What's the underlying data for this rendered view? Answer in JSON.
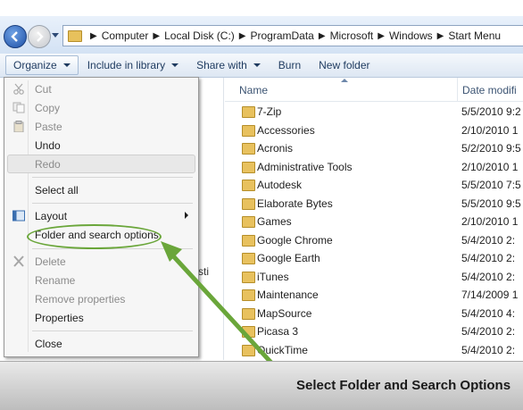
{
  "address": {
    "crumbs": [
      "Computer",
      "Local Disk (C:)",
      "ProgramData",
      "Microsoft",
      "Windows",
      "Start Menu"
    ]
  },
  "toolbar": {
    "organize": "Organize",
    "include": "Include in library",
    "share": "Share with",
    "burn": "Burn",
    "new_folder": "New folder"
  },
  "nav": {
    "partial_text": "sti"
  },
  "list": {
    "col_name": "Name",
    "col_date": "Date modifi",
    "rows": [
      {
        "name": "7-Zip",
        "date": "5/5/2010 9:2"
      },
      {
        "name": "Accessories",
        "date": "2/10/2010 1"
      },
      {
        "name": "Acronis",
        "date": "5/2/2010 9:5"
      },
      {
        "name": "Administrative Tools",
        "date": "2/10/2010 1"
      },
      {
        "name": "Autodesk",
        "date": "5/5/2010 7:5"
      },
      {
        "name": "Elaborate Bytes",
        "date": "5/5/2010 9:5"
      },
      {
        "name": "Games",
        "date": "2/10/2010 1"
      },
      {
        "name": "Google Chrome",
        "date": "5/4/2010 2:"
      },
      {
        "name": "Google Earth",
        "date": "5/4/2010 2:"
      },
      {
        "name": "iTunes",
        "date": "5/4/2010 2:"
      },
      {
        "name": "Maintenance",
        "date": "7/14/2009 1"
      },
      {
        "name": "MapSource",
        "date": "5/4/2010 4:"
      },
      {
        "name": "Picasa 3",
        "date": "5/4/2010 2:"
      },
      {
        "name": "QuickTime",
        "date": "5/4/2010 2:"
      }
    ]
  },
  "menu": {
    "cut": "Cut",
    "copy": "Copy",
    "paste": "Paste",
    "undo": "Undo",
    "redo": "Redo",
    "select_all": "Select all",
    "layout": "Layout",
    "folder_options": "Folder and search options",
    "delete": "Delete",
    "rename": "Rename",
    "remove_props": "Remove properties",
    "properties": "Properties",
    "close": "Close"
  },
  "caption": "Select Folder and Search Options",
  "colors": {
    "annotation": "#6aa63a",
    "folder": "#e8c15e"
  }
}
